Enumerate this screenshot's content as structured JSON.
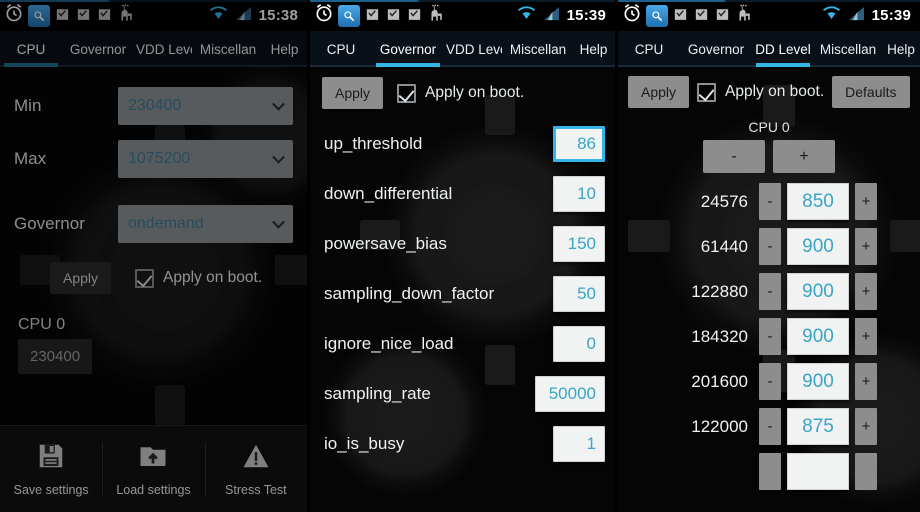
{
  "statusbar": {
    "icons": [
      "alarm-clock-icon",
      "app-tuner-icon",
      "checkbag-icon",
      "checkbag-icon",
      "checkbag-icon",
      "llama-icon"
    ],
    "right_icons": [
      "wifi-icon",
      "signal-icon"
    ],
    "time_panel1": "15:38",
    "time_panel2": "15:39",
    "time_panel3": "15:39",
    "accent": "#33b5e5"
  },
  "tabs": {
    "labels": [
      "CPU",
      "Governor",
      "VDD Leve",
      "Miscellan",
      "Help"
    ],
    "labels_panel3": [
      "CPU",
      "Governor",
      "DD Level",
      "Miscellan",
      "Help"
    ],
    "active_panel1": "CPU",
    "active_panel2": "Governor",
    "active_panel3": "DD Level"
  },
  "panel1": {
    "fields": [
      {
        "label": "Min",
        "value": "230400"
      },
      {
        "label": "Max",
        "value": "1075200"
      },
      {
        "label": "Governor",
        "value": "ondemand"
      }
    ],
    "apply_label": "Apply",
    "apply_on_boot_label": "Apply on boot.",
    "cpu_title": "CPU 0",
    "cpu_freq": "230400",
    "bottombar": [
      {
        "icon": "floppy-save-icon",
        "label": "Save settings"
      },
      {
        "icon": "folder-upload-icon",
        "label": "Load settings"
      },
      {
        "icon": "warning-triangle-icon",
        "label": "Stress Test"
      }
    ]
  },
  "panel2": {
    "apply_label": "Apply",
    "apply_on_boot_label": "Apply on boot.",
    "params": [
      {
        "name": "up_threshold",
        "value": "86",
        "focused": true,
        "wide": false
      },
      {
        "name": "down_differential",
        "value": "10",
        "focused": false,
        "wide": false
      },
      {
        "name": "powersave_bias",
        "value": "150",
        "focused": false,
        "wide": false
      },
      {
        "name": "sampling_down_factor",
        "value": "50",
        "focused": false,
        "wide": false
      },
      {
        "name": "ignore_nice_load",
        "value": "0",
        "focused": false,
        "wide": false
      },
      {
        "name": "sampling_rate",
        "value": "50000",
        "focused": false,
        "wide": true
      },
      {
        "name": "io_is_busy",
        "value": "1",
        "focused": false,
        "wide": false
      }
    ]
  },
  "panel3": {
    "apply_label": "Apply",
    "apply_on_boot_label": "Apply on boot.",
    "defaults_label": "Defaults",
    "cpu_title": "CPU 0",
    "global_minus": "-",
    "global_plus": "+",
    "minus_label": "-",
    "plus_label": "+",
    "rows": [
      {
        "freq": "24576",
        "mv": "850"
      },
      {
        "freq": "61440",
        "mv": "900"
      },
      {
        "freq": "122880",
        "mv": "900"
      },
      {
        "freq": "184320",
        "mv": "900"
      },
      {
        "freq": "201600",
        "mv": "900"
      },
      {
        "freq": "122000",
        "mv": "875"
      }
    ]
  }
}
